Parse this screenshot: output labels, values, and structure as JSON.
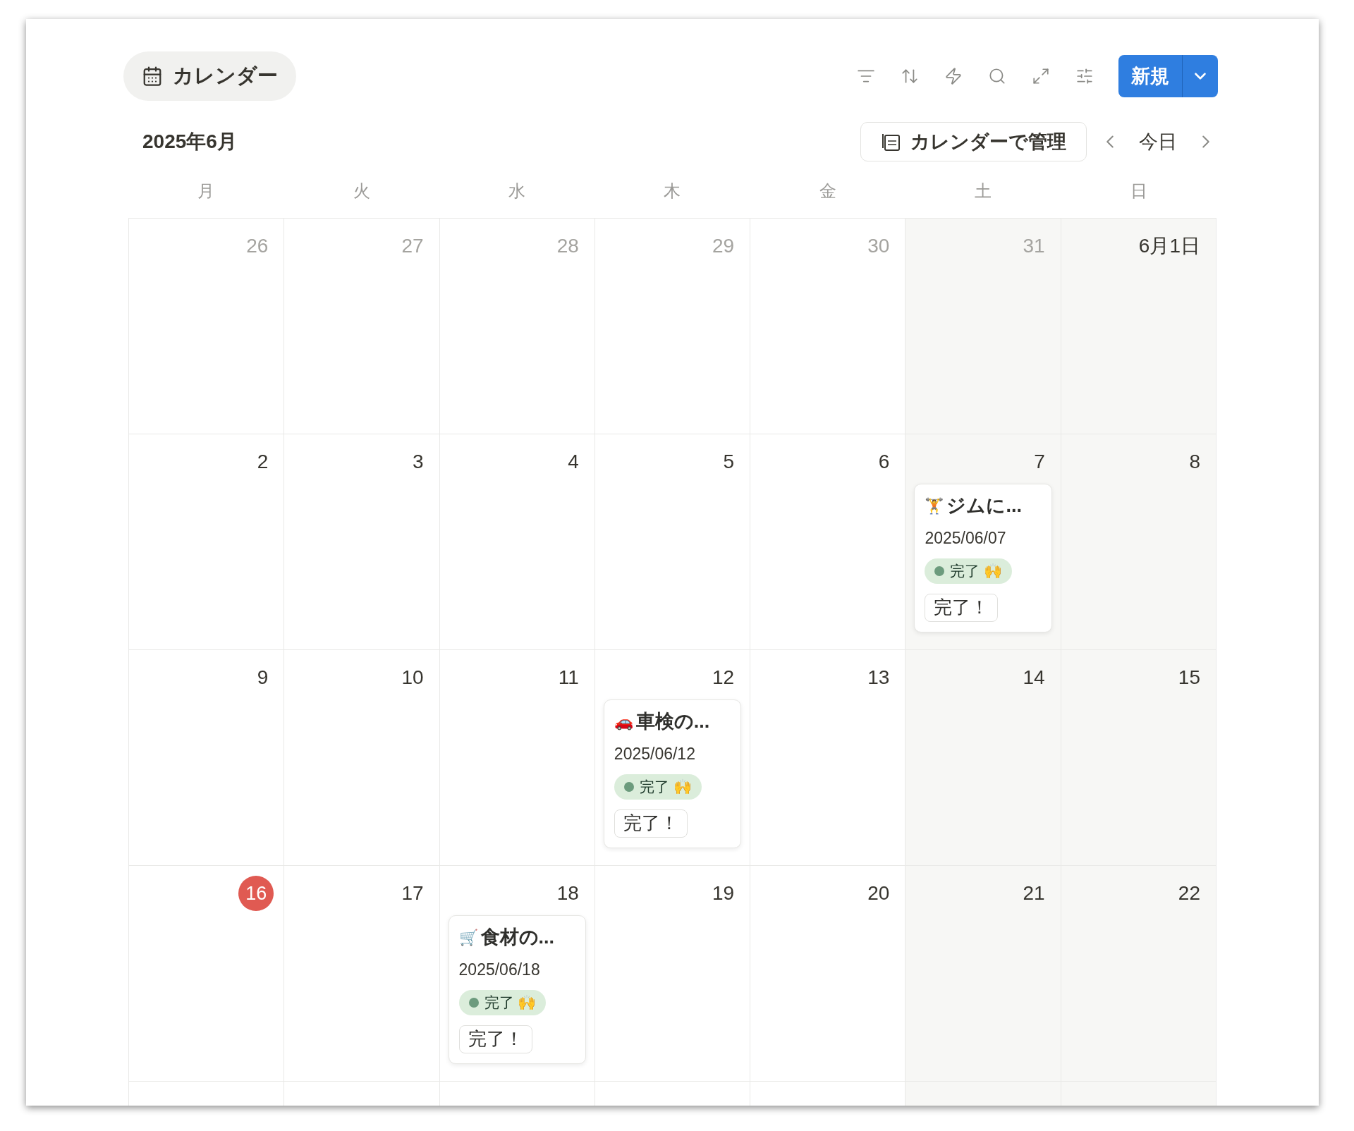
{
  "view_title": "カレンダー",
  "new_button": {
    "label": "新規"
  },
  "month": "2025年6月",
  "manage_button": {
    "label": "カレンダーで管理"
  },
  "today_button": {
    "label": "今日"
  },
  "weekdays": [
    {
      "label": "月",
      "color": "#ffffff"
    },
    {
      "label": "火",
      "color": "#ffffff"
    },
    {
      "label": "水",
      "color": "#ffffff"
    },
    {
      "label": "木",
      "color": "#ffffff"
    },
    {
      "label": "金",
      "color": "#ffffff"
    },
    {
      "label": "土",
      "color": "#f7f7f5"
    },
    {
      "label": "日",
      "color": "#f7f7f5"
    }
  ],
  "weeks": [
    {
      "days": [
        {
          "label": "26",
          "muted": true,
          "today": false
        },
        {
          "label": "27",
          "muted": true,
          "today": false
        },
        {
          "label": "28",
          "muted": true,
          "today": false
        },
        {
          "label": "29",
          "muted": true,
          "today": false
        },
        {
          "label": "30",
          "muted": true,
          "today": false
        },
        {
          "label": "31",
          "muted": true,
          "today": false
        },
        {
          "label": "6月1日",
          "muted": false,
          "today": false
        }
      ]
    },
    {
      "days": [
        {
          "label": "2",
          "muted": false,
          "today": false
        },
        {
          "label": "3",
          "muted": false,
          "today": false
        },
        {
          "label": "4",
          "muted": false,
          "today": false
        },
        {
          "label": "5",
          "muted": false,
          "today": false
        },
        {
          "label": "6",
          "muted": false,
          "today": false
        },
        {
          "label": "7",
          "muted": false,
          "today": false,
          "events": [
            {
              "emoji": "🏋️",
              "title": "ジムに...",
              "date": "2025/06/07",
              "status": "完了 🙌",
              "tag": "完了！"
            }
          ]
        },
        {
          "label": "8",
          "muted": false,
          "today": false
        }
      ]
    },
    {
      "days": [
        {
          "label": "9",
          "muted": false,
          "today": false
        },
        {
          "label": "10",
          "muted": false,
          "today": false
        },
        {
          "label": "11",
          "muted": false,
          "today": false
        },
        {
          "label": "12",
          "muted": false,
          "today": false,
          "events": [
            {
              "emoji": "🚗",
              "title": "車検の...",
              "date": "2025/06/12",
              "status": "完了 🙌",
              "tag": "完了！"
            }
          ]
        },
        {
          "label": "13",
          "muted": false,
          "today": false
        },
        {
          "label": "14",
          "muted": false,
          "today": false
        },
        {
          "label": "15",
          "muted": false,
          "today": false
        }
      ]
    },
    {
      "days": [
        {
          "label": "16",
          "muted": false,
          "today": true
        },
        {
          "label": "17",
          "muted": false,
          "today": false
        },
        {
          "label": "18",
          "muted": false,
          "today": false,
          "events": [
            {
              "emoji": "🛒",
              "title": "食材の...",
              "date": "2025/06/18",
              "status": "完了 🙌",
              "tag": "完了！"
            }
          ]
        },
        {
          "label": "19",
          "muted": false,
          "today": false
        },
        {
          "label": "20",
          "muted": false,
          "today": false
        },
        {
          "label": "21",
          "muted": false,
          "today": false
        },
        {
          "label": "22",
          "muted": false,
          "today": false
        }
      ]
    }
  ],
  "next_week_cut_off": true
}
